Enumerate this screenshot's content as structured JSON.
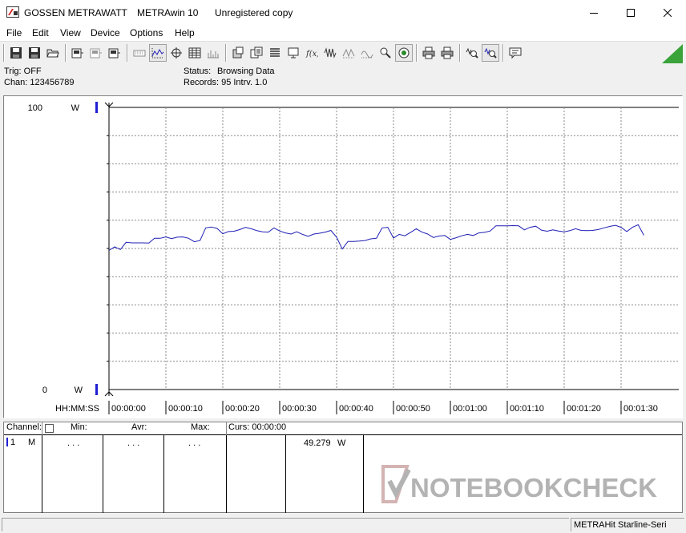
{
  "window": {
    "brand": "GOSSEN METRAWATT",
    "app": "METRAwin 10",
    "license": "Unregistered copy"
  },
  "menu": [
    "File",
    "Edit",
    "View",
    "Device",
    "Options",
    "Help"
  ],
  "info": {
    "trig": "Trig: OFF",
    "chan": "Chan:  123456789",
    "status_label": "Status:",
    "status_value": "Browsing Data",
    "records": "Records: 95   Intrv. 1.0"
  },
  "chart_data": {
    "type": "line",
    "ylim": [
      0,
      100
    ],
    "y_top_label": "100",
    "y_bottom_label": "0",
    "y_unit": "W",
    "x_axis_label": "HH:MM:SS",
    "x_ticks": [
      "00:00:00",
      "00:00:10",
      "00:00:20",
      "00:00:30",
      "00:00:40",
      "00:00:50",
      "00:01:00",
      "00:01:10",
      "00:01:20",
      "00:01:30"
    ],
    "grid": true,
    "line_color": "#1f1fb4",
    "series": [
      {
        "x": [
          0,
          1,
          2,
          3,
          4,
          5,
          6,
          7,
          8,
          9,
          10,
          11,
          12,
          13,
          14,
          15,
          16,
          17,
          18,
          19,
          20,
          21,
          22,
          23,
          24,
          25,
          26,
          27,
          28,
          29,
          30,
          31,
          32,
          33,
          34,
          35,
          36,
          37,
          38,
          39,
          40,
          41,
          42,
          43,
          44,
          45,
          46,
          47,
          48,
          49,
          50,
          51,
          52,
          53,
          54,
          55,
          56,
          57,
          58,
          59,
          60,
          61,
          62,
          63,
          64,
          65,
          66,
          67,
          68,
          69,
          70,
          71,
          72,
          73,
          74,
          75,
          76,
          77,
          78,
          79,
          80,
          81,
          82,
          83,
          84,
          85,
          86,
          87,
          88,
          89,
          90,
          91,
          92,
          93,
          94
        ],
        "values": [
          49.3,
          50.6,
          49.6,
          52.2,
          52.0,
          52.0,
          52.0,
          51.9,
          53.6,
          53.6,
          54.1,
          53.5,
          54.0,
          54.1,
          53.6,
          52.4,
          52.8,
          57.3,
          57.6,
          57.1,
          55.2,
          56.0,
          56.1,
          56.7,
          57.5,
          57.0,
          56.3,
          55.9,
          55.8,
          57.3,
          56.2,
          55.5,
          55.1,
          55.9,
          55.0,
          54.3,
          55.1,
          55.4,
          55.8,
          56.4,
          54.0,
          49.8,
          52.5,
          52.5,
          52.6,
          52.8,
          53.4,
          53.6,
          57.3,
          57.5,
          53.7,
          55.0,
          54.5,
          55.7,
          57.0,
          55.8,
          55.1,
          53.9,
          54.4,
          54.6,
          53.2,
          53.8,
          54.5,
          55.0,
          54.6,
          55.5,
          55.7,
          56.2,
          58.0,
          58.0,
          58.0,
          58.1,
          58.0,
          56.6,
          57.5,
          57.9,
          56.5,
          56.1,
          56.6,
          56.2,
          55.9,
          56.3,
          57.0,
          56.4,
          56.3,
          56.4,
          56.7,
          57.3,
          57.8,
          58.2,
          57.5,
          56.0,
          57.5,
          58.4,
          54.7
        ]
      }
    ]
  },
  "table": {
    "headers": [
      "Channel:",
      "Min:",
      "Avr:",
      "Max:",
      "Curs:  00:00:00"
    ],
    "row": {
      "channel": "1",
      "mode": "M",
      "min": ". . .",
      "avr": ". . .",
      "max": ". . .",
      "value": "49.279",
      "unit": "W"
    }
  },
  "statusbar": {
    "device": "METRAHit Starline-Seri"
  },
  "watermark": "NOTEBOOKCHECK",
  "icons": {
    "toolbar": [
      "save-disk-icon",
      "save-disk-icon",
      "open-folder-icon",
      "device-icon",
      "device-icon",
      "device-icon",
      "keyboard-icon",
      "autoscale-icon",
      "cursor-crosshair-icon",
      "table-view-icon",
      "histogram-icon",
      "export-icon",
      "copy-icon",
      "list-icon",
      "monitor-icon",
      "function-icon",
      "wave-icon",
      "wave-icon",
      "wave-icon",
      "zoom-wave-icon",
      "target-icon",
      "print-icon",
      "print-preview-icon",
      "zoom-icon",
      "zoom-fit-icon",
      "comment-icon"
    ]
  },
  "colors": {
    "trace": "#1f1fb4",
    "marker": "#1f1fd2",
    "watermark": "#b3b3b3"
  }
}
